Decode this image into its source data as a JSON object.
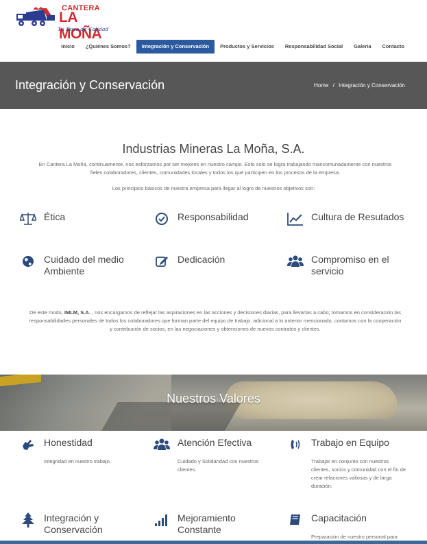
{
  "logo": {
    "top_text": "CANTERA",
    "main_text": "LA MOÑA",
    "tagline": "Tu Roca de Calidad"
  },
  "nav": {
    "items": [
      {
        "label": "Inicio",
        "active": false
      },
      {
        "label": "¿Quiénes Somos?",
        "active": false
      },
      {
        "label": "Integración y Conservación",
        "active": true
      },
      {
        "label": "Productos y Servicios",
        "active": false
      },
      {
        "label": "Responsabilidad Social",
        "active": false
      },
      {
        "label": "Galeria",
        "active": false
      },
      {
        "label": "Contacto",
        "active": false
      }
    ]
  },
  "titlebar": {
    "title": "Integración y Conservación",
    "breadcrumb_home": "Home",
    "breadcrumb_sep": "/",
    "breadcrumb_current": "Integración y Conservación"
  },
  "intro": {
    "company_title": "Industrias Mineras La Moña, S.A.",
    "paragraph": "En Cantera La Moña, continuamente, nos esforzamos por ser mejores en nuestro campo. Esto solo se logra trabajando mancomunadamente con nuestros fieles colaboradores, clientes, comunidades locales y todos los que participen en los procesos de la empresa.",
    "principles_intro": "Los principios básicos de nuestra empresa para llegar al logro de nuestros objetivos son:"
  },
  "principles": [
    {
      "label": "Ética",
      "icon": "balance-scale-icon"
    },
    {
      "label": "Responsabilidad",
      "icon": "check-circle-icon"
    },
    {
      "label": "Cultura de Resutados",
      "icon": "line-chart-icon"
    },
    {
      "label": "Cuidado del medio Ambiente",
      "icon": "globe-icon"
    },
    {
      "label": "Dedicación",
      "icon": "edit-icon"
    },
    {
      "label": "Compromiso en el servicio",
      "icon": "users-icon"
    }
  ],
  "closing": {
    "prefix": "De este modo,",
    "bold": "IMLM, S.A.",
    "suffix": ", nos encargamos de reflejar las aspiraciones en las acciones y decisiones diarias, para llevarlas a cabo; tomamos en consideración las responsabilidades personales de todos los colaboradores que forman parte del equipo de trabajo. adicional a lo anterior mencionado, contamos con la cooperación y contribución de socios, en las negociaciones y obtenciones de nuevos contratos y clientes."
  },
  "banner": {
    "title": "Nuestros Valores"
  },
  "values": [
    {
      "label": "Honestidad",
      "icon": "sign-language-icon",
      "desc": "Integridad en nuestro trabajo."
    },
    {
      "label": "Atención Efectiva",
      "icon": "users-icon",
      "desc": "Cuidado y Solidaridad con nuestros clientes."
    },
    {
      "label": "Trabajo en Equipo",
      "icon": "volume-control-phone-icon",
      "desc": "Trabajar en conjunto con nuestros clientes, socios y comunidad con el fin de crear relaciones valiosas y de larga duración."
    },
    {
      "label": "Integración y Conservación",
      "icon": "tree-icon",
      "desc": ""
    },
    {
      "label": "Mejoramiento Constante",
      "icon": "signal-icon",
      "desc": ""
    },
    {
      "label": "Capacitación",
      "icon": "book-icon",
      "desc": "Preparación de nuestro personal para"
    }
  ],
  "colors": {
    "accent": "#2c5aa0",
    "logo_red": "#d42a2f",
    "titlebar": "#575757",
    "icon": "#2c4a7c"
  }
}
